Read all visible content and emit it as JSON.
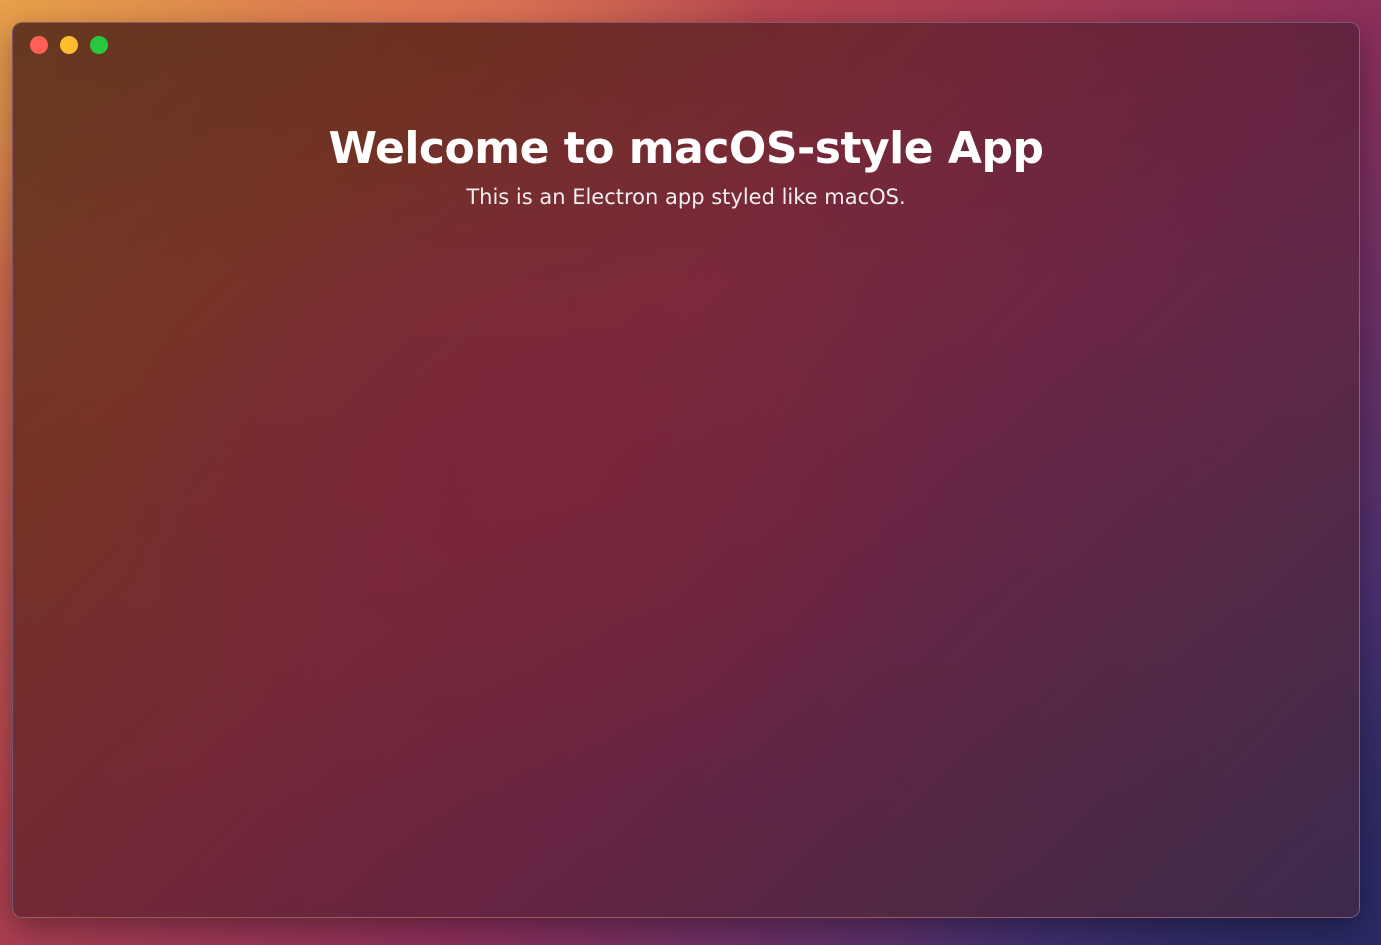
{
  "window": {
    "traffic_lights": [
      {
        "name": "close",
        "color": "#ff5f57"
      },
      {
        "name": "minimize",
        "color": "#febc2e"
      },
      {
        "name": "maximize",
        "color": "#28c840"
      }
    ]
  },
  "main": {
    "title": "Welcome to macOS-style App",
    "subtitle": "This is an Electron app styled like macOS."
  }
}
